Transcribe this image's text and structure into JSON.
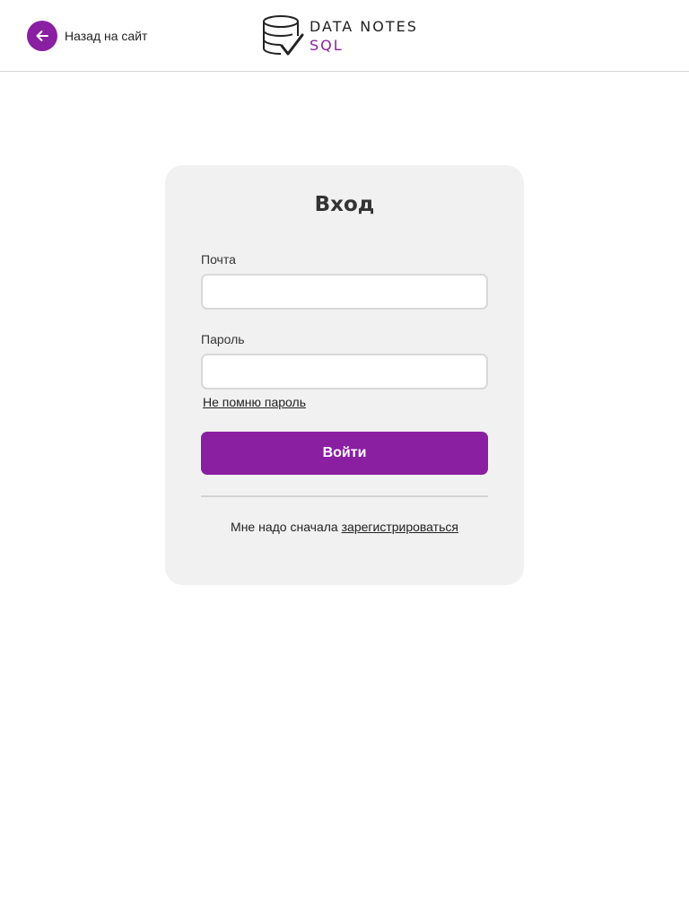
{
  "header": {
    "back_label": "Назад на сайт",
    "back_icon": "arrow-left-icon",
    "logo": {
      "line1": "DATA NOTES",
      "line2": "SQL",
      "icon": "database-check-icon"
    }
  },
  "login": {
    "title": "Вход",
    "email_label": "Почта",
    "email_value": "",
    "password_label": "Пароль",
    "password_value": "",
    "forgot_password": "Не помню пароль",
    "submit_label": "Войти",
    "register_prefix": "Мне надо сначала",
    "register_link": "зарегистрироваться"
  },
  "colors": {
    "accent": "#8a1fa2",
    "card_background": "#f1f1f1",
    "text": "#222222"
  }
}
